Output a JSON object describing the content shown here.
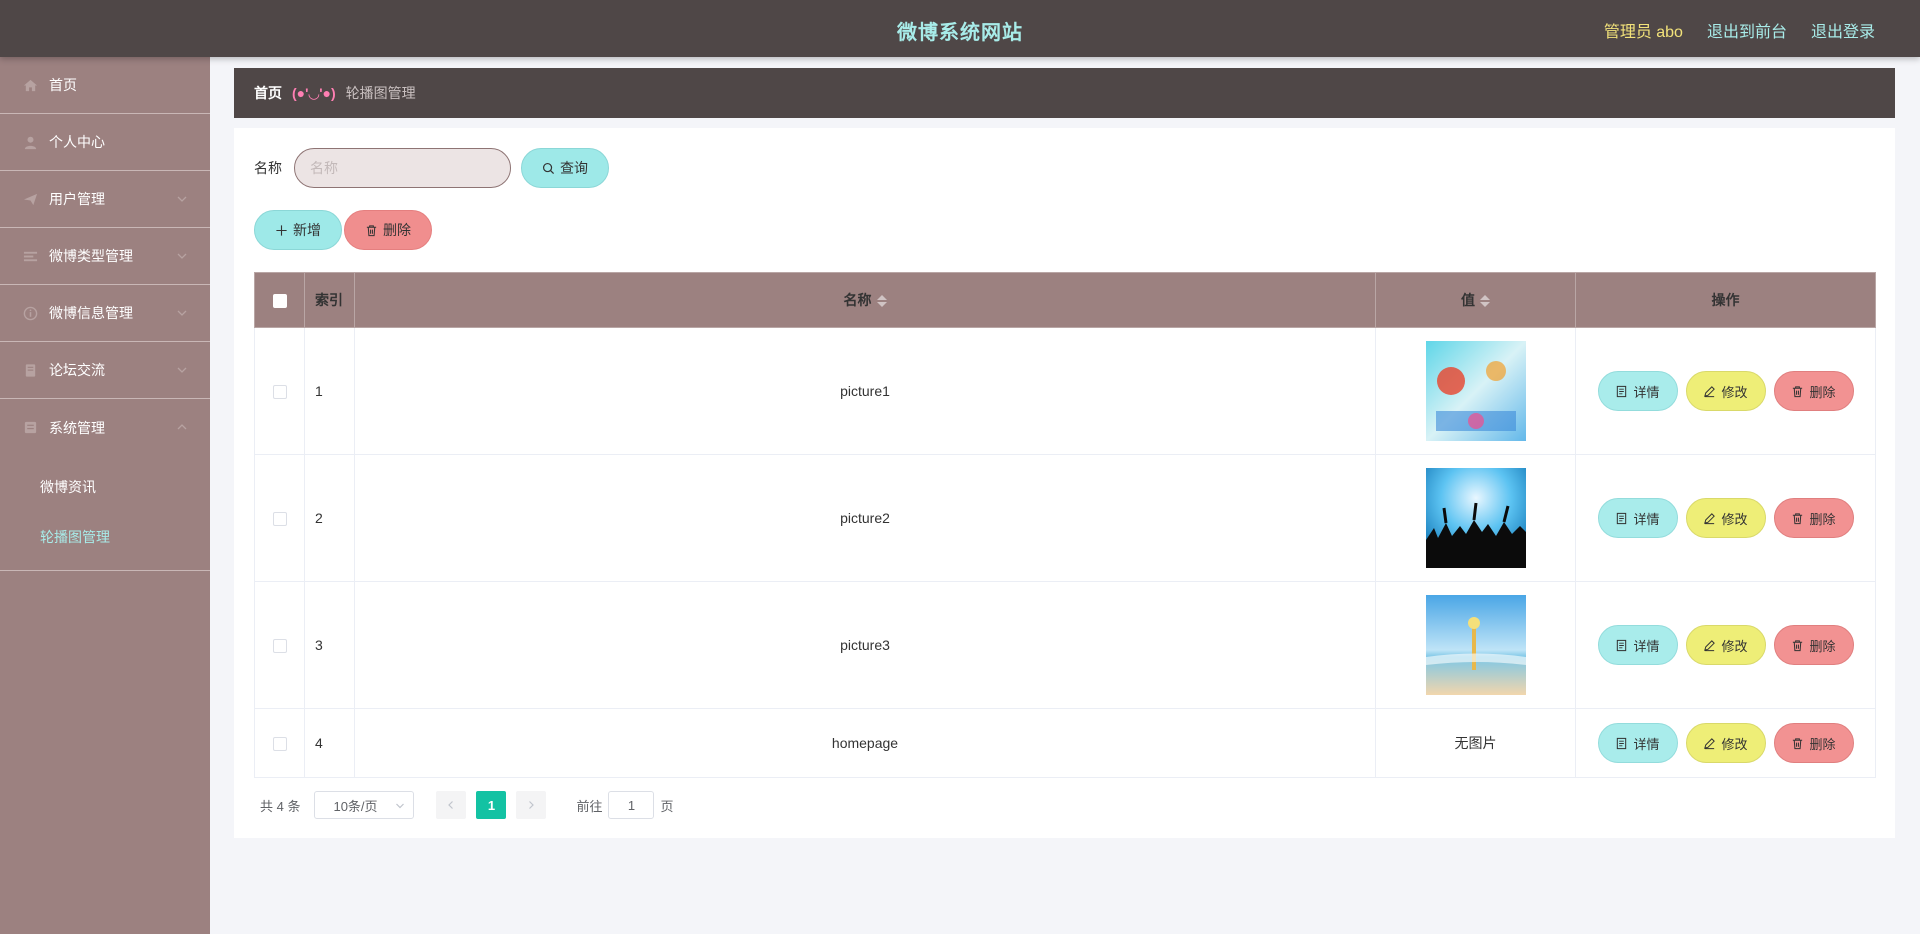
{
  "header": {
    "title": "微博系统网站",
    "admin_label": "管理员 abo",
    "to_front": "退出到前台",
    "logout": "退出登录"
  },
  "sidebar": {
    "items": [
      {
        "label": "首页",
        "icon": "home-icon"
      },
      {
        "label": "个人中心",
        "icon": "user-icon"
      },
      {
        "label": "用户管理",
        "icon": "send-icon"
      },
      {
        "label": "微博类型管理",
        "icon": "list-icon"
      },
      {
        "label": "微博信息管理",
        "icon": "info-icon"
      },
      {
        "label": "论坛交流",
        "icon": "document-icon"
      },
      {
        "label": "系统管理",
        "icon": "system-icon"
      }
    ],
    "submenu": [
      {
        "label": "微博资讯"
      },
      {
        "label": "轮播图管理",
        "active": true
      }
    ]
  },
  "breadcrumb": {
    "home": "首页",
    "face": "(●'◡'●)",
    "current": "轮播图管理"
  },
  "search": {
    "label": "名称",
    "placeholder": "名称",
    "button": "查询"
  },
  "actions": {
    "add": "新增",
    "delete": "删除"
  },
  "table": {
    "columns": [
      "索引",
      "名称",
      "值",
      "操作"
    ],
    "rows": [
      {
        "index": "1",
        "name": "picture1",
        "value": "image",
        "image": "festival-poster-image"
      },
      {
        "index": "2",
        "name": "picture2",
        "value": "image",
        "image": "concert-crowd-image"
      },
      {
        "index": "3",
        "name": "picture3",
        "value": "image",
        "image": "beach-scene-image"
      },
      {
        "index": "4",
        "name": "homepage",
        "value": "无图片"
      }
    ],
    "op_detail": "详情",
    "op_edit": "修改",
    "op_delete": "删除"
  },
  "pagination": {
    "total": "共 4 条",
    "page_size": "10条/页",
    "current_page": "1",
    "goto_label": "前往",
    "goto_value": "1",
    "page_suffix": "页"
  },
  "colors": {
    "topbar": "#4f4747",
    "sidebar": "#9c8180",
    "accent_cyan": "#9ee9e8",
    "danger": "#f08e8e",
    "edit_yellow": "#eeee77",
    "page_active": "#13c2a3"
  }
}
